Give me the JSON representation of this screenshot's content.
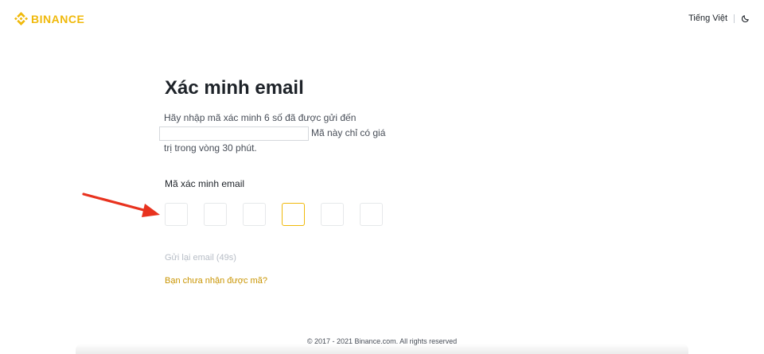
{
  "header": {
    "brand": "BINANCE",
    "language": "Tiếng Việt",
    "theme_icon": "moon-icon"
  },
  "main": {
    "title": "Xác minh email",
    "desc_part1": "Hãy nhập mã xác minh 6 số đã được gửi đến",
    "desc_part2": "Mã này chỉ có giá",
    "desc_part3": "trị trong vòng 30 phút.",
    "code_label": "Mã xác minh email",
    "resend": "Gửi lại email (49s)",
    "not_received": "Bạn chưa nhận được mã?"
  },
  "colors": {
    "brand": "#f0b90b",
    "link": "#c99400",
    "annotation_arrow": "#e8321e"
  },
  "footer": {
    "copyright": "© 2017 - 2021 Binance.com. All rights reserved"
  }
}
